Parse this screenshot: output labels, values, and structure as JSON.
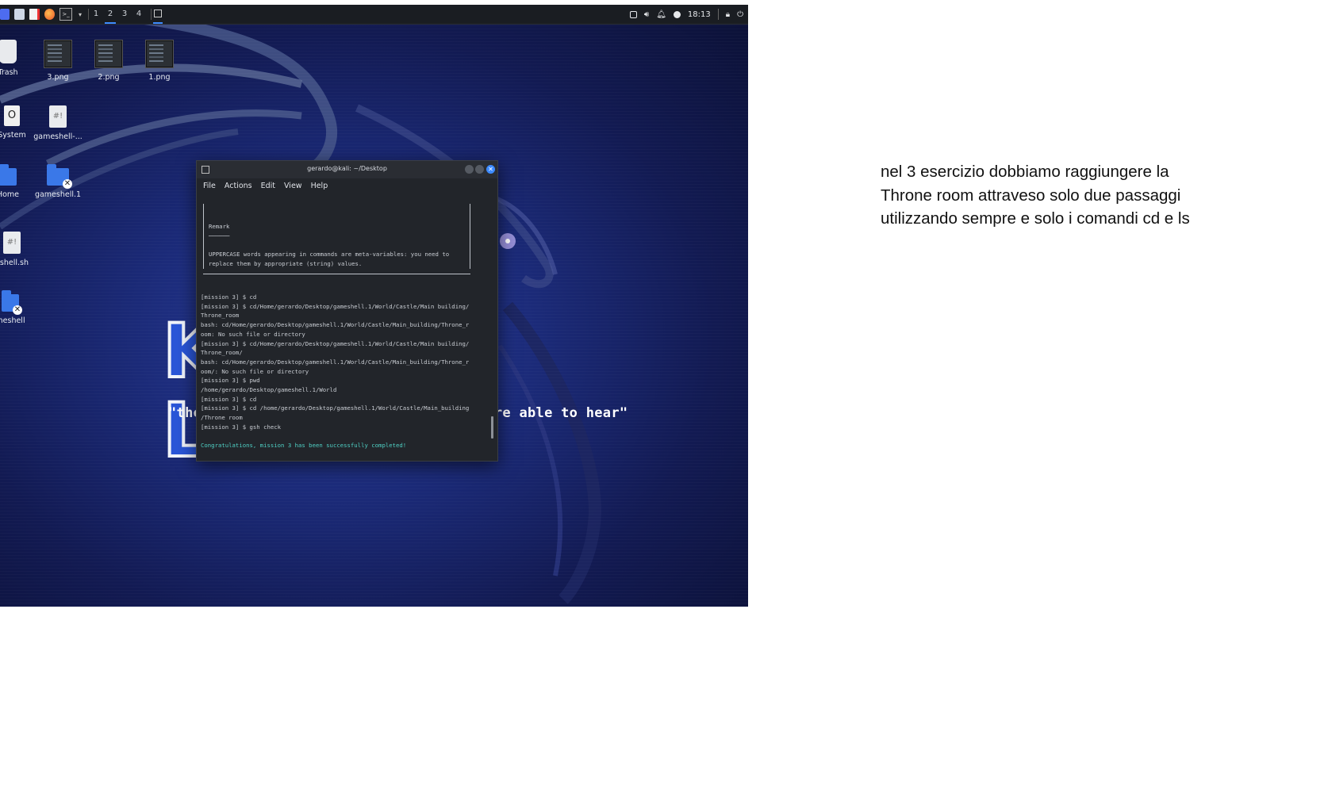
{
  "panel": {
    "workspaces": [
      "1",
      "2",
      "3",
      "4"
    ],
    "active_workspace": "2",
    "clock": "18:13"
  },
  "desktop_icons": [
    {
      "label": "Trash",
      "icon": "trash-icon"
    },
    {
      "label": "3.png",
      "icon": "image-thumbnail-icon"
    },
    {
      "label": "2.png",
      "icon": "image-thumbnail-icon"
    },
    {
      "label": "1.png",
      "icon": "image-thumbnail-icon"
    },
    {
      "label": "System",
      "icon": "system-icon"
    },
    {
      "label": "gameshell-...",
      "icon": "script-file-icon"
    },
    {
      "label": "Home",
      "icon": "home-folder-icon"
    },
    {
      "label": "gameshell.1",
      "icon": "folder-icon"
    },
    {
      "label": "eshell.sh",
      "icon": "locked-file-icon"
    },
    {
      "label": "meshell",
      "icon": "folder-icon"
    }
  ],
  "wallpaper": {
    "logo_text": "KALI LINUX",
    "quote": "\"the quieter you become, the more you are able to hear\""
  },
  "terminal": {
    "title": "gerardo@kali: ~/Desktop",
    "menu": [
      "File",
      "Actions",
      "Edit",
      "View",
      "Help"
    ],
    "remark_title": "Remark",
    "remark_line1": "UPPERCASE words appearing in commands are meta-variables: you need to",
    "remark_line2": "replace them by appropriate (string) values.",
    "lines": [
      "[mission 3] $ cd",
      "[mission 3] $ cd/Home/gerardo/Desktop/gameshell.1/World/Castle/Main building/",
      "Throne_room",
      "bash: cd/Home/gerardo/Desktop/gameshell.1/World/Castle/Main_building/Throne_r",
      "oom: No such file or directory",
      "[mission 3] $ cd/Home/gerardo/Desktop/gameshell.1/World/Castle/Main building/",
      "Throne_room/",
      "bash: cd/Home/gerardo/Desktop/gameshell.1/World/Castle/Main_building/Throne_r",
      "oom/: No such file or directory",
      "[mission 3] $ pwd",
      "/home/gerardo/Desktop/gameshell.1/World",
      "[mission 3] $ cd",
      "[mission 3] $ cd /home/gerardo/Desktop/gameshell.1/World/Castle/Main_building",
      "/Throne room",
      "[mission 3] $ gsh check"
    ],
    "success": "Congratulations, mission 3 has been successfully completed!"
  },
  "note": {
    "text": "nel 3 esercizio dobbiamo raggiungere la Throne room attraveso solo due passaggi utilizzando sempre e solo i comandi cd e ls"
  },
  "colors": {
    "accent": "#3d8bff",
    "success": "#4fd1c5",
    "terminal_bg": "#22252a"
  }
}
